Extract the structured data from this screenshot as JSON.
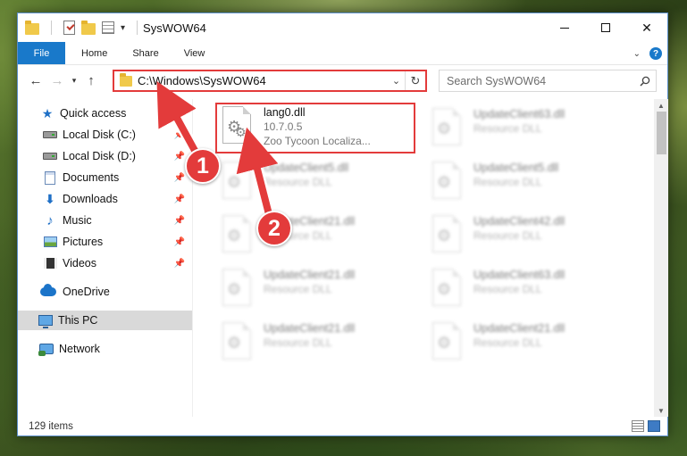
{
  "window": {
    "title": "SysWOW64",
    "controls": {
      "minimize": "─",
      "maximize": "☐",
      "close": "✕"
    }
  },
  "ribbon": {
    "tabs": [
      {
        "label": "File",
        "active": true
      },
      {
        "label": "Home"
      },
      {
        "label": "Share"
      },
      {
        "label": "View"
      }
    ],
    "help": "?"
  },
  "navigation": {
    "address": "C:\\Windows\\SysWOW64",
    "search_placeholder": "Search SysWOW64"
  },
  "sidebar": {
    "items": [
      {
        "label": "Quick access",
        "icon": "star-icon"
      },
      {
        "label": "Local Disk (C:)",
        "icon": "drive-icon",
        "pinned": true
      },
      {
        "label": "Local Disk (D:)",
        "icon": "drive-icon",
        "pinned": true
      },
      {
        "label": "Documents",
        "icon": "documents-icon",
        "pinned": true
      },
      {
        "label": "Downloads",
        "icon": "downloads-icon",
        "pinned": true
      },
      {
        "label": "Music",
        "icon": "music-icon",
        "pinned": true
      },
      {
        "label": "Pictures",
        "icon": "pictures-icon",
        "pinned": true
      },
      {
        "label": "Videos",
        "icon": "videos-icon",
        "pinned": true
      },
      {
        "label": "OneDrive",
        "icon": "onedrive-icon"
      },
      {
        "label": "This PC",
        "icon": "this-pc-icon",
        "selected": true
      },
      {
        "label": "Network",
        "icon": "network-icon"
      }
    ]
  },
  "files": {
    "highlighted": {
      "name": "lang0.dll",
      "version": "10.7.0.5",
      "description": "Zoo Tycoon Localiza..."
    },
    "background_items": [
      {
        "name": "UpdateClient63.dll",
        "type": "Resource DLL"
      },
      {
        "name": "UpdateClient5.dll",
        "type": "Resource DLL"
      },
      {
        "name": "UpdateClient5.dll",
        "type": "Resource DLL"
      },
      {
        "name": "UpdateClient21.dll",
        "type": "Resource DLL"
      },
      {
        "name": "UpdateClient42.dll",
        "type": "Resource DLL"
      },
      {
        "name": "UpdateClient21.dll",
        "type": "Resource DLL"
      },
      {
        "name": "UpdateClient63.dll",
        "type": "Resource DLL"
      },
      {
        "name": "UpdateClient21.dll",
        "type": "Resource DLL"
      },
      {
        "name": "UpdateClient21.dll",
        "type": "Resource DLL"
      }
    ]
  },
  "status": {
    "item_count": "129 items"
  },
  "annotations": {
    "step1": "1",
    "step2": "2",
    "color": "#e33b3b"
  }
}
